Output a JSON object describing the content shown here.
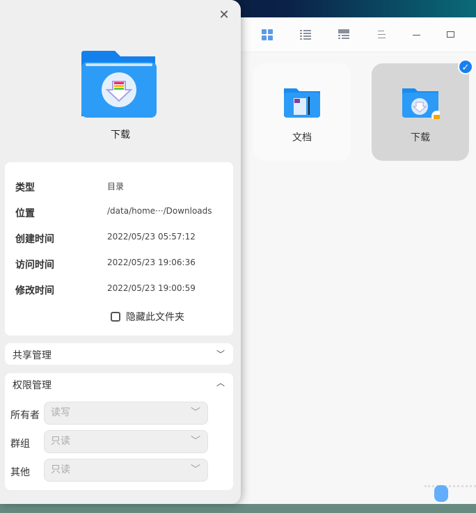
{
  "dialog": {
    "title": "下载",
    "close_icon": "close-icon",
    "properties": [
      {
        "key": "类型",
        "value": "目录"
      },
      {
        "key": "位置",
        "value": "/data/home···/Downloads"
      },
      {
        "key": "创建时间",
        "value": "2022/05/23 05:57:12"
      },
      {
        "key": "访问时间",
        "value": "2022/05/23 19:06:36"
      },
      {
        "key": "修改时间",
        "value": "2022/05/23 19:00:59"
      }
    ],
    "hide_folder_label": "隐藏此文件夹",
    "share_section": "共享管理",
    "permission_section": "权限管理",
    "permissions": [
      {
        "label": "所有者",
        "value": "读写"
      },
      {
        "label": "群组",
        "value": "只读"
      },
      {
        "label": "其他",
        "value": "只读"
      }
    ]
  },
  "file_manager": {
    "items": [
      {
        "name": "文档"
      },
      {
        "name": "下载",
        "selected": true
      }
    ]
  },
  "colors": {
    "accent": "#1a7ff0"
  }
}
